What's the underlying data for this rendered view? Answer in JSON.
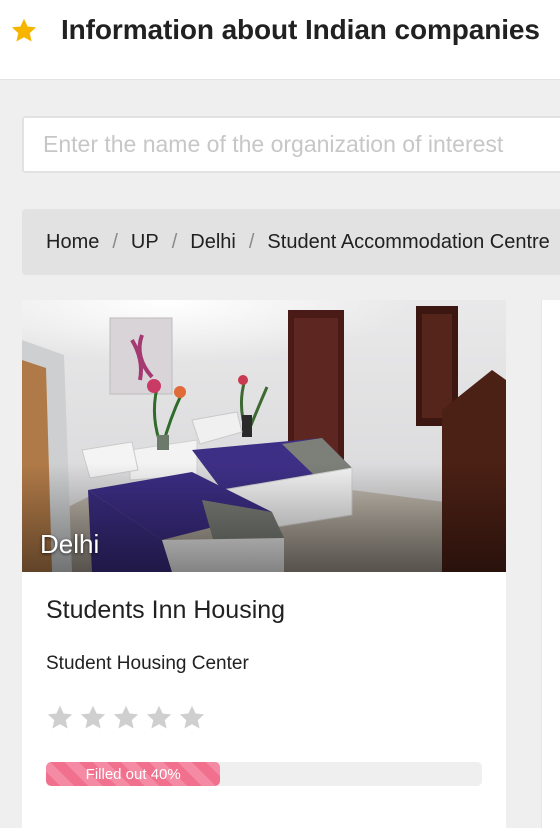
{
  "header": {
    "title": "Information about Indian companies",
    "icon": "star-icon",
    "icon_color": "#f7b500"
  },
  "search": {
    "placeholder": "Enter the name of the organization of interest",
    "value": ""
  },
  "breadcrumb": [
    {
      "label": "Home"
    },
    {
      "label": "UP"
    },
    {
      "label": "Delhi"
    },
    {
      "label": "Student Accommodation Centre"
    }
  ],
  "breadcrumb_separator": "/",
  "card": {
    "city": "Delhi",
    "name": "Students Inn Housing",
    "category": "Student Housing Center",
    "rating": 0,
    "rating_max": 5,
    "filled_percent": 40,
    "filled_label": "Filled out 40%",
    "accent_color": "#f0708e"
  }
}
